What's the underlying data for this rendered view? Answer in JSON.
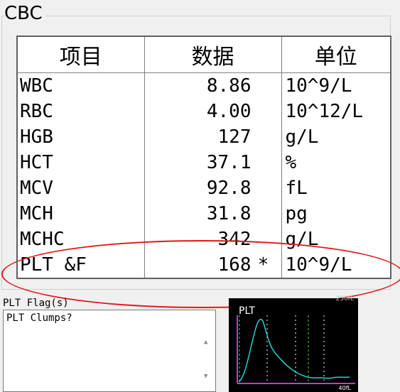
{
  "group": {
    "title": "CBC"
  },
  "table": {
    "headers": {
      "item": "项目",
      "value": "数据",
      "unit": "单位"
    },
    "rows": [
      {
        "name": "WBC",
        "value": "8.86",
        "flag": "",
        "unit": "10^9/L"
      },
      {
        "name": "RBC",
        "value": "4.00",
        "flag": "",
        "unit": "10^12/L"
      },
      {
        "name": "HGB",
        "value": "127",
        "flag": "",
        "unit": "g/L"
      },
      {
        "name": "HCT",
        "value": "37.1",
        "flag": "",
        "unit": "%"
      },
      {
        "name": "MCV",
        "value": "92.8",
        "flag": "",
        "unit": "fL"
      },
      {
        "name": "MCH",
        "value": "31.8",
        "flag": "",
        "unit": "pg"
      },
      {
        "name": "MCHC",
        "value": "342",
        "flag": "",
        "unit": "g/L"
      },
      {
        "name": "PLT &F",
        "value": "168",
        "flag": "*",
        "unit": "10^9/L"
      }
    ]
  },
  "flags": {
    "label": "PLT Flag(s)",
    "items": [
      "PLT Clumps?"
    ]
  },
  "histogram": {
    "title": "PLT",
    "scale_label": "250fL",
    "x_label": "40fL",
    "colors": {
      "curve": "#22d3d3",
      "axis": "#c040c0",
      "marker_green": "#4fdc4f",
      "marker_white": "#ffffff"
    }
  },
  "colors": {
    "highlight": "#e11818"
  }
}
